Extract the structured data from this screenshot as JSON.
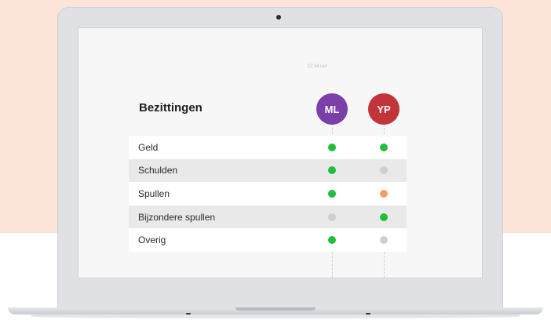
{
  "timestamp": "22:34 uur",
  "title": "Bezittingen",
  "people": [
    {
      "initials": "ML",
      "color": "#7a3fa8"
    },
    {
      "initials": "YP",
      "color": "#c3343a"
    }
  ],
  "status_colors": {
    "done": "#1fbf3b",
    "none": "#cfcfcf",
    "pending": "#f2a06b"
  },
  "rows": [
    {
      "label": "Geld",
      "ml": "done",
      "yp": "done"
    },
    {
      "label": "Schulden",
      "ml": "done",
      "yp": "none"
    },
    {
      "label": "Spullen",
      "ml": "done",
      "yp": "pending"
    },
    {
      "label": "Bijzondere spullen",
      "ml": "none",
      "yp": "done"
    },
    {
      "label": "Overig",
      "ml": "done",
      "yp": "none"
    }
  ]
}
